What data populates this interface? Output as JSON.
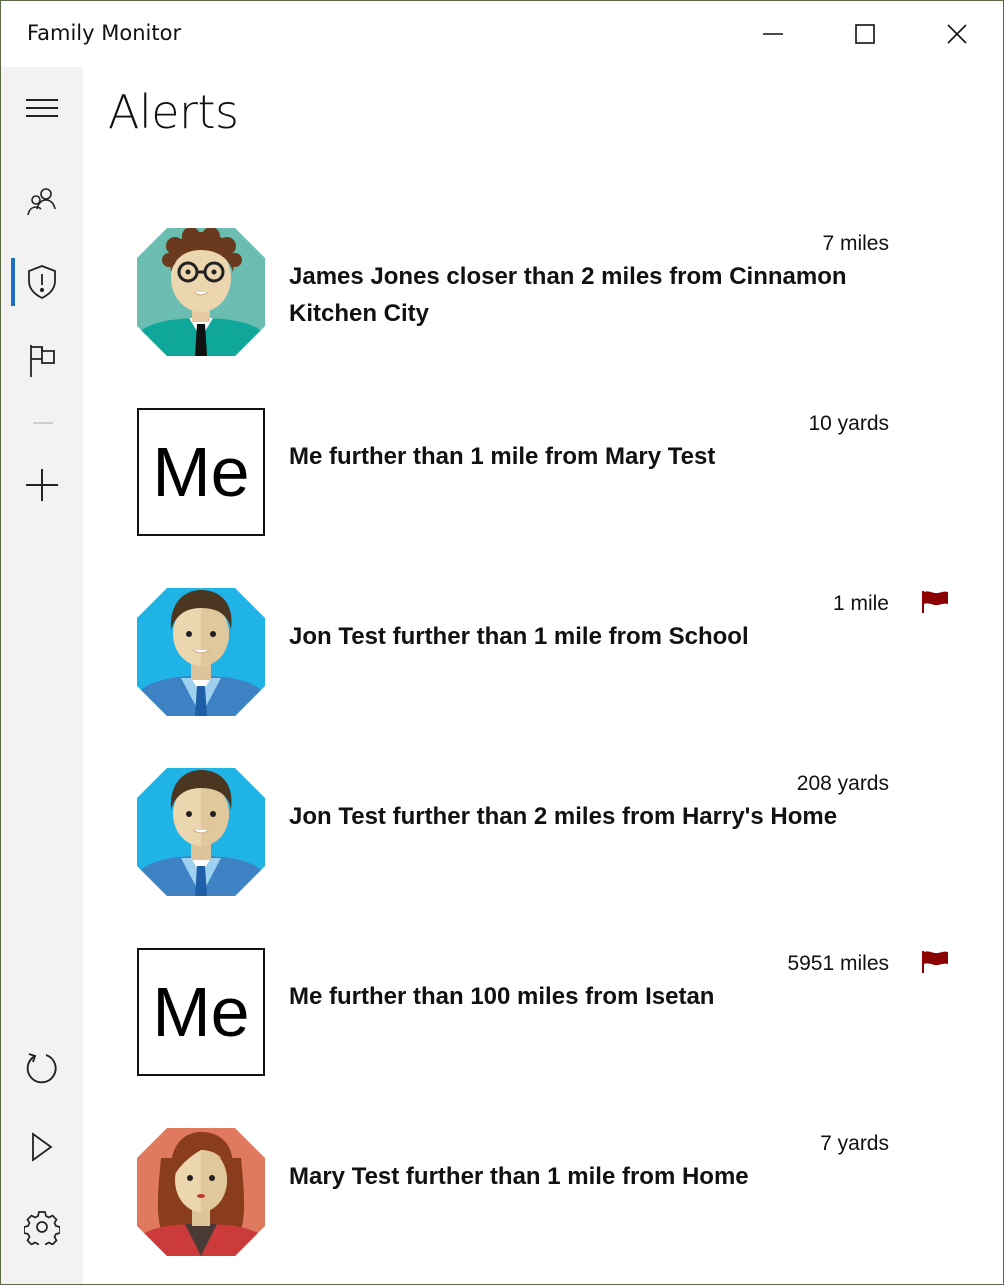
{
  "window": {
    "title": "Family Monitor"
  },
  "page": {
    "title": "Alerts"
  },
  "nav": {
    "items": [
      {
        "icon": "hamburger-menu-icon"
      },
      {
        "icon": "people-icon"
      },
      {
        "icon": "shield-alert-icon",
        "selected": true
      },
      {
        "icon": "flag-icon"
      },
      {
        "icon": "add-icon"
      },
      {
        "icon": "refresh-icon"
      },
      {
        "icon": "play-icon"
      },
      {
        "icon": "settings-gear-icon"
      }
    ],
    "accent_color": "#1e6fc6"
  },
  "alerts": [
    {
      "avatar": "man-glasses-teal",
      "distance": "7 miles",
      "message": "James Jones closer than 2 miles from Cinnamon Kitchen City",
      "flagged": false
    },
    {
      "avatar": "me-tile",
      "avatar_text": "Me",
      "distance": "10 yards",
      "message": "Me further than 1 mile from Mary Test",
      "flagged": false
    },
    {
      "avatar": "man-blue",
      "distance": "1 mile",
      "message": "Jon Test further than 1 mile from School",
      "flagged": true
    },
    {
      "avatar": "man-blue",
      "distance": "208 yards",
      "message": "Jon Test further than 2 miles from Harry's Home",
      "flagged": false
    },
    {
      "avatar": "me-tile",
      "avatar_text": "Me",
      "distance": "5951 miles",
      "message": "Me further than 100 miles from Isetan",
      "flagged": true
    },
    {
      "avatar": "woman-red",
      "distance": "7 yards",
      "message": "Mary Test further than 1 mile from Home",
      "flagged": false
    }
  ],
  "colors": {
    "flag": "#8b0000",
    "nav_background": "#f2f2f2"
  }
}
